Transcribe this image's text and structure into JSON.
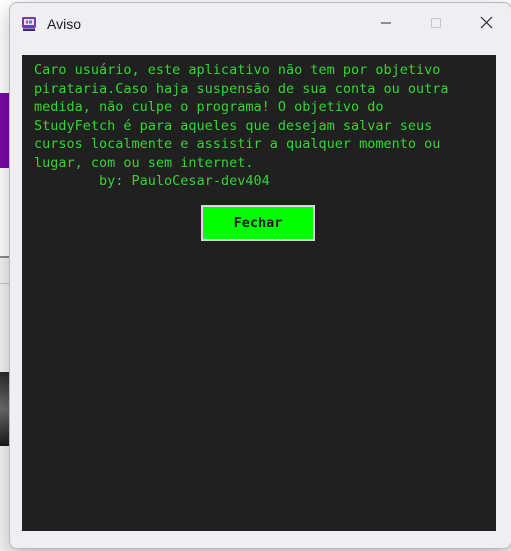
{
  "window": {
    "title": "Aviso",
    "icon": "studyfetch-app-icon",
    "controls": {
      "minimize_icon": "minimize-icon",
      "maximize_icon": "maximize-icon",
      "maximize_enabled": false,
      "close_icon": "close-icon"
    }
  },
  "dialog": {
    "message": "Caro usuário, este aplicativo não tem por objetivo\npirataria.Caso haja suspensão de sua conta ou outra\nmedida, não culpe o programa! O objetivo do\nStudyFetch é para aqueles que desejam salvar seus\ncursos localmente e assistir a qualquer momento ou\nlugar, com ou sem internet.\n        by: PauloCesar-dev404",
    "button_label": "Fechar"
  },
  "colors": {
    "panel_background": "#202020",
    "text": "#33d433",
    "button_background": "#00ff00"
  }
}
